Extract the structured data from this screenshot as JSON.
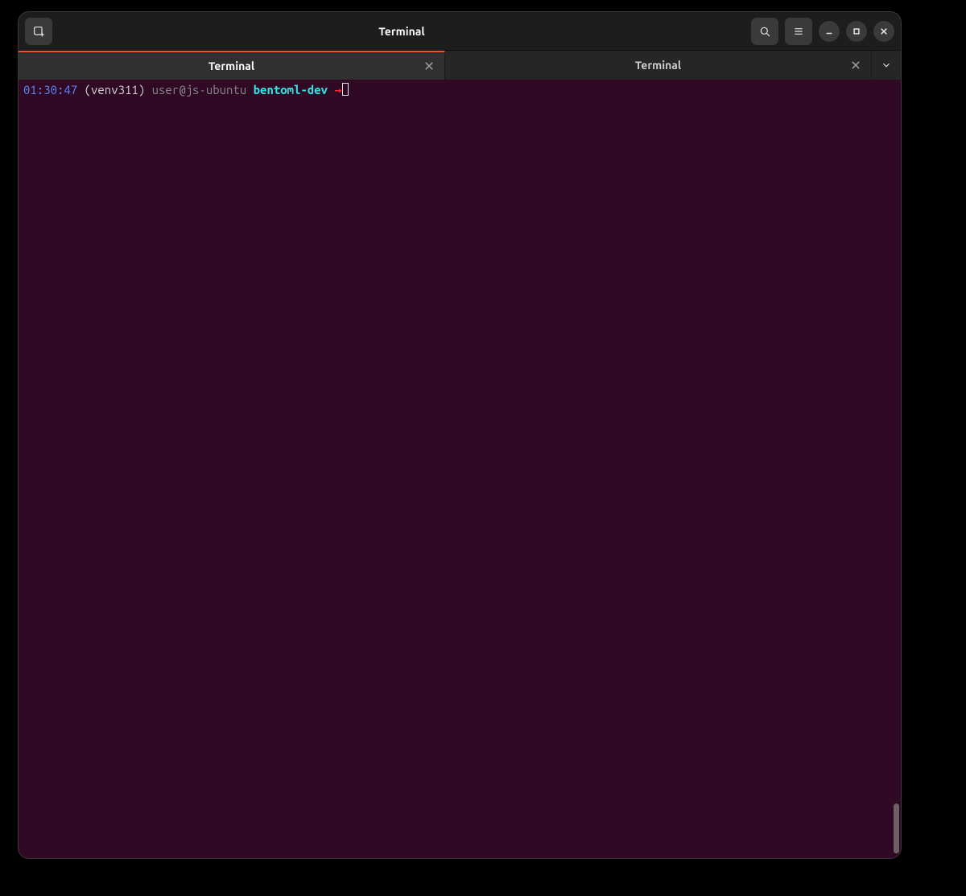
{
  "window": {
    "title": "Terminal"
  },
  "tabs": [
    {
      "label": "Terminal",
      "active": true
    },
    {
      "label": "Terminal",
      "active": false
    }
  ],
  "prompt": {
    "time": "01:30:47",
    "venv": "(venv311)",
    "user_host": "user@js-ubuntu",
    "cwd": "bentoml-dev",
    "arrow": "→"
  }
}
